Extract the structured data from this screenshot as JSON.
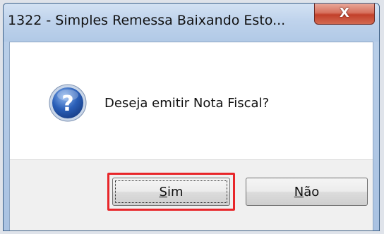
{
  "window": {
    "title": "1322 - Simples Remessa Baixando Esto...",
    "close_label": "X"
  },
  "dialog": {
    "message": "Deseja emitir Nota Fiscal?",
    "icon": "question-icon"
  },
  "buttons": {
    "yes": {
      "mnemonic": "S",
      "rest": "im"
    },
    "no": {
      "mnemonic": "N",
      "rest": "ão"
    }
  },
  "colors": {
    "highlight": "#e8262a",
    "icon_blue": "#2a5fb8"
  }
}
